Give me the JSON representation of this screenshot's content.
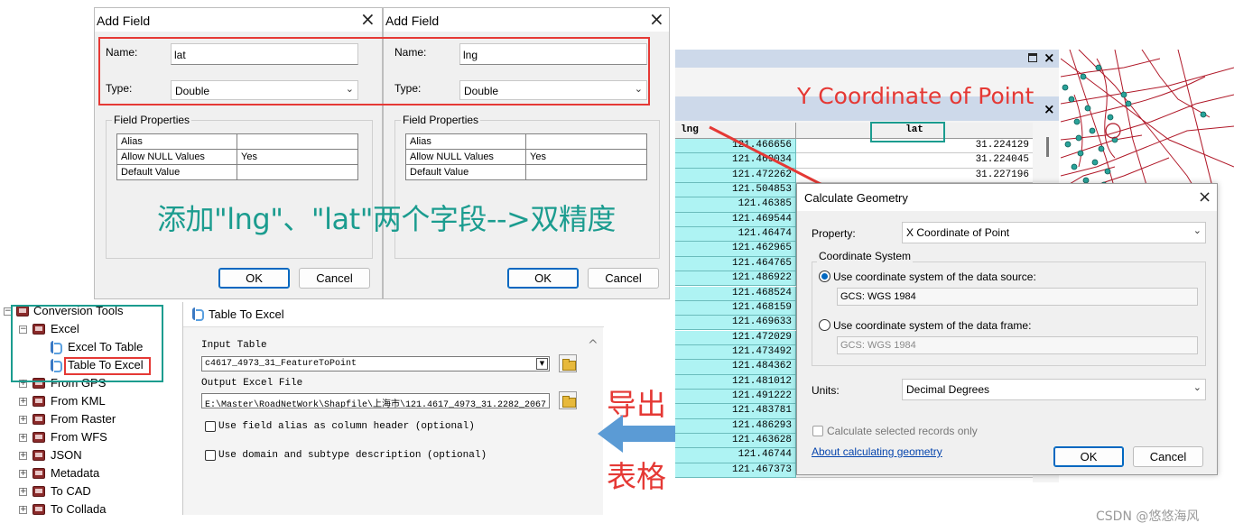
{
  "add_field_1": {
    "title": "Add Field",
    "name_label": "Name:",
    "name_value": "lat",
    "type_label": "Type:",
    "type_value": "Double",
    "field_properties": "Field Properties",
    "props": [
      {
        "key": "Alias",
        "value": ""
      },
      {
        "key": "Allow NULL Values",
        "value": "Yes"
      },
      {
        "key": "Default Value",
        "value": ""
      }
    ],
    "ok": "OK",
    "cancel": "Cancel"
  },
  "add_field_2": {
    "title": "Add Field",
    "name_label": "Name:",
    "name_value": "lng",
    "type_label": "Type:",
    "type_value": "Double",
    "field_properties": "Field Properties",
    "props": [
      {
        "key": "Alias",
        "value": ""
      },
      {
        "key": "Allow NULL Values",
        "value": "Yes"
      },
      {
        "key": "Default Value",
        "value": ""
      }
    ],
    "ok": "OK",
    "cancel": "Cancel"
  },
  "annotations": {
    "add_fields_note": "添加\"lng\"、\"lat\"两个字段-->双精度",
    "export_line1": "导出",
    "export_line2": "表格",
    "y_coord_label": "Y Coordinate of Point",
    "watermark": "CSDN @悠悠海风"
  },
  "toolbox": {
    "items": [
      {
        "label": "Conversion Tools",
        "expander": "−"
      },
      {
        "label": "Excel",
        "expander": "−"
      },
      {
        "label": "Excel To Table"
      },
      {
        "label": "Table To Excel"
      },
      {
        "label": "From GPS",
        "expander": "+"
      },
      {
        "label": "From KML",
        "expander": "+"
      },
      {
        "label": "From Raster",
        "expander": "+"
      },
      {
        "label": "From WFS",
        "expander": "+"
      },
      {
        "label": "JSON",
        "expander": "+"
      },
      {
        "label": "Metadata",
        "expander": "+"
      },
      {
        "label": "To CAD",
        "expander": "+"
      },
      {
        "label": "To Collada",
        "expander": "+"
      }
    ]
  },
  "table_to_excel": {
    "title": "Table To Excel",
    "input_table_label": "Input Table",
    "input_table_value": "c4617_4973_31_FeatureToPoint",
    "output_file_label": "Output Excel File",
    "output_file_value": "E:\\Master\\RoadNetWork\\Shapfile\\上海市\\121.4617_4973_31.2282_2067",
    "option1": "Use field alias as column header (optional)",
    "option2": "Use domain and subtype description (optional)"
  },
  "attribute_table": {
    "col_lng": "lng",
    "col_lat": "lat",
    "rows": [
      {
        "lng": "121.466656",
        "lat": "31.224129"
      },
      {
        "lng": "121.469034",
        "lat": "31.224045"
      },
      {
        "lng": "121.472262",
        "lat": "31.227196"
      },
      {
        "lng": "121.504853",
        "lat": ""
      },
      {
        "lng": "121.46385",
        "lat": ""
      },
      {
        "lng": "121.469544",
        "lat": ""
      },
      {
        "lng": "121.46474",
        "lat": ""
      },
      {
        "lng": "121.462965",
        "lat": ""
      },
      {
        "lng": "121.464765",
        "lat": ""
      },
      {
        "lng": "121.486922",
        "lat": ""
      },
      {
        "lng": "121.468524",
        "lat": ""
      },
      {
        "lng": "121.468159",
        "lat": ""
      },
      {
        "lng": "121.469633",
        "lat": ""
      },
      {
        "lng": "121.472029",
        "lat": ""
      },
      {
        "lng": "121.473492",
        "lat": ""
      },
      {
        "lng": "121.484362",
        "lat": ""
      },
      {
        "lng": "121.481012",
        "lat": ""
      },
      {
        "lng": "121.491222",
        "lat": ""
      },
      {
        "lng": "121.483781",
        "lat": ""
      },
      {
        "lng": "121.486293",
        "lat": ""
      },
      {
        "lng": "121.463628",
        "lat": ""
      },
      {
        "lng": "121.46744",
        "lat": ""
      },
      {
        "lng": "121.467373",
        "lat": ""
      }
    ]
  },
  "calculate_geometry": {
    "title": "Calculate Geometry",
    "property_label": "Property:",
    "property_value": "X Coordinate of Point",
    "coord_system_group": "Coordinate System",
    "radio1_label": "Use coordinate system of the data source:",
    "radio1_value": "GCS: WGS 1984",
    "radio2_label": "Use coordinate system of the data frame:",
    "radio2_value": "GCS: WGS 1984",
    "units_label": "Units:",
    "units_value": "Decimal Degrees",
    "selected_only": "Calculate selected records only",
    "help_link": "About calculating geometry",
    "ok": "OK",
    "cancel": "Cancel"
  },
  "colors": {
    "annotation_red": "#e53935",
    "annotation_teal": "#1b9c8f",
    "lng_column_bg": "#aef3f3",
    "map_road": "#b01828",
    "map_point": "#2aa39a"
  }
}
